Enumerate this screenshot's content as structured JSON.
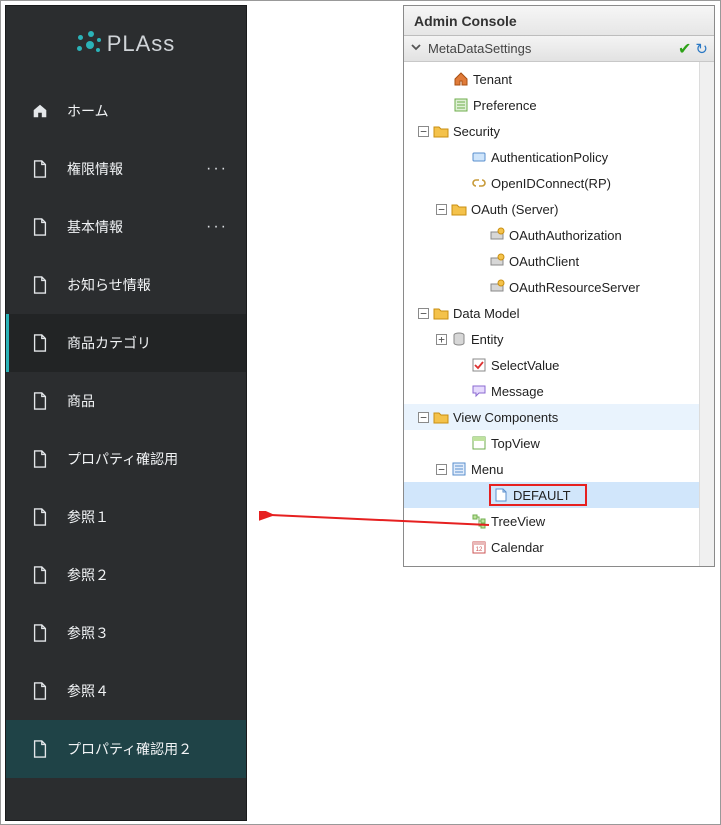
{
  "sidebar": {
    "logo_text": "PLAss",
    "logo_prefix": "·i·",
    "items": [
      {
        "label": "ホーム",
        "icon": "home",
        "dots": false
      },
      {
        "label": "権限情報",
        "icon": "file",
        "dots": true
      },
      {
        "label": "基本情報",
        "icon": "file",
        "dots": true
      },
      {
        "label": "お知らせ情報",
        "icon": "file",
        "dots": false
      },
      {
        "label": "商品カテゴリ",
        "icon": "file",
        "dots": false,
        "state": "active1"
      },
      {
        "label": "商品",
        "icon": "file",
        "dots": false
      },
      {
        "label": "プロパティ確認用",
        "icon": "file",
        "dots": false
      },
      {
        "label": "参照１",
        "icon": "file",
        "dots": false
      },
      {
        "label": "参照２",
        "icon": "file",
        "dots": false
      },
      {
        "label": "参照３",
        "icon": "file",
        "dots": false
      },
      {
        "label": "参照４",
        "icon": "file",
        "dots": false
      },
      {
        "label": "プロパティ確認用２",
        "icon": "file",
        "dots": false,
        "state": "active2"
      }
    ]
  },
  "console": {
    "title": "Admin Console",
    "section": {
      "label": "MetaDataSettings",
      "check": "✔",
      "refresh": "↻"
    },
    "tree": [
      {
        "depth": 1,
        "exp": null,
        "icon": "home",
        "label": "Tenant"
      },
      {
        "depth": 1,
        "exp": null,
        "icon": "form",
        "label": "Preference"
      },
      {
        "depth": 0,
        "exp": "-",
        "icon": "folder",
        "label": "Security"
      },
      {
        "depth": 2,
        "exp": null,
        "icon": "badge",
        "label": "AuthenticationPolicy"
      },
      {
        "depth": 2,
        "exp": null,
        "icon": "link",
        "label": "OpenIDConnect(RP)"
      },
      {
        "depth": 1,
        "exp": "-",
        "icon": "folder",
        "label": "OAuth (Server)"
      },
      {
        "depth": 3,
        "exp": null,
        "icon": "svr",
        "label": "OAuthAuthorization"
      },
      {
        "depth": 3,
        "exp": null,
        "icon": "svr",
        "label": "OAuthClient"
      },
      {
        "depth": 3,
        "exp": null,
        "icon": "svr",
        "label": "OAuthResourceServer"
      },
      {
        "depth": 0,
        "exp": "-",
        "icon": "folder",
        "label": "Data Model"
      },
      {
        "depth": 1,
        "exp": "+",
        "icon": "db",
        "label": "Entity"
      },
      {
        "depth": 2,
        "exp": null,
        "icon": "sel",
        "label": "SelectValue"
      },
      {
        "depth": 2,
        "exp": null,
        "icon": "msg",
        "label": "Message"
      },
      {
        "depth": 0,
        "exp": "-",
        "icon": "folder",
        "label": "View Components",
        "hl": "hl2"
      },
      {
        "depth": 2,
        "exp": null,
        "icon": "top",
        "label": "TopView"
      },
      {
        "depth": 1,
        "exp": "-",
        "icon": "menu",
        "label": "Menu"
      },
      {
        "depth": 3,
        "exp": null,
        "icon": "page",
        "label": "DEFAULT",
        "hl": "hl",
        "box": true
      },
      {
        "depth": 2,
        "exp": null,
        "icon": "tree",
        "label": "TreeView"
      },
      {
        "depth": 2,
        "exp": null,
        "icon": "cal",
        "label": "Calendar"
      }
    ]
  }
}
